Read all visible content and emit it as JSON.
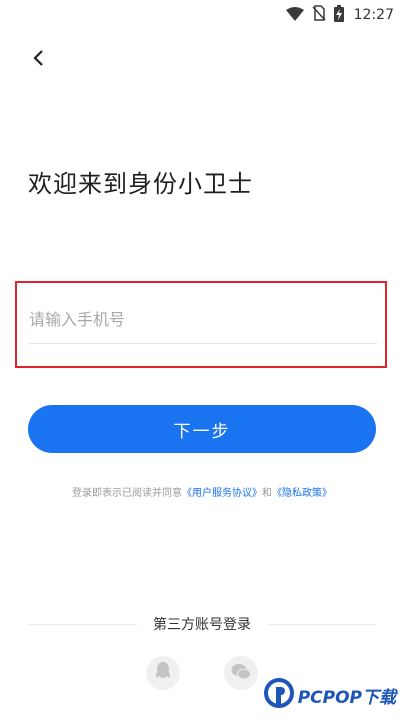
{
  "status_bar": {
    "time": "12:27",
    "icons": [
      "wifi-icon",
      "no-sim-icon",
      "battery-charging-icon"
    ]
  },
  "nav": {
    "back_icon": "chevron-left-icon"
  },
  "welcome_title": "欢迎来到身份小卫士",
  "phone_input": {
    "value": "",
    "placeholder": "请输入手机号"
  },
  "next_button_label": "下一步",
  "agreement": {
    "prefix": "登录即表示已阅读并同意",
    "user_agreement": "《用户服务协议》",
    "and": "和",
    "privacy_policy": "《隐私政策》"
  },
  "third_party": {
    "label": "第三方账号登录",
    "providers": [
      "qq-icon",
      "wechat-icon"
    ]
  },
  "watermark": {
    "text": "PCPOP下载"
  },
  "colors": {
    "accent": "#1a73f0",
    "highlight_border": "#e0242d"
  }
}
